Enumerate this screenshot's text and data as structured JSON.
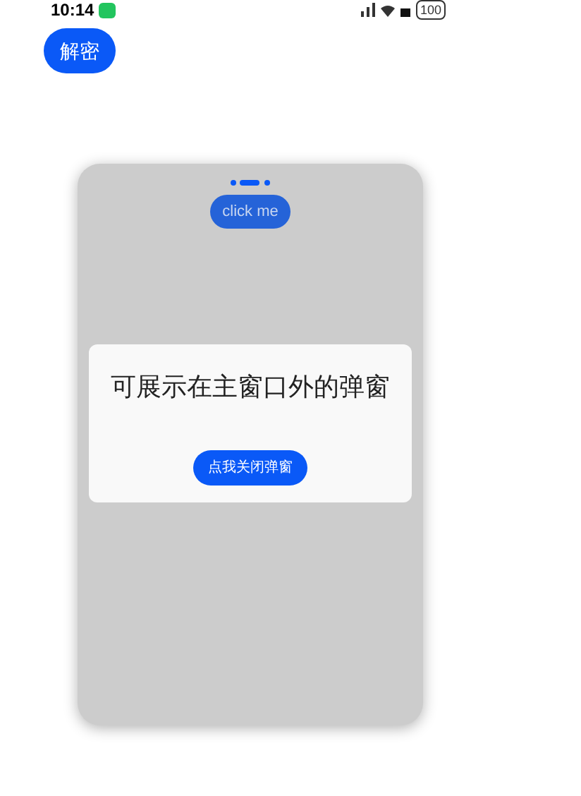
{
  "status_bar": {
    "time": "10:14",
    "battery": "100"
  },
  "decrypt_button": {
    "label": "解密"
  },
  "window_preview": {
    "click_button": {
      "label": "click me"
    },
    "dialog": {
      "title": "可展示在主窗口外的弹窗",
      "close_button": {
        "label": "点我关闭弹窗"
      }
    }
  }
}
